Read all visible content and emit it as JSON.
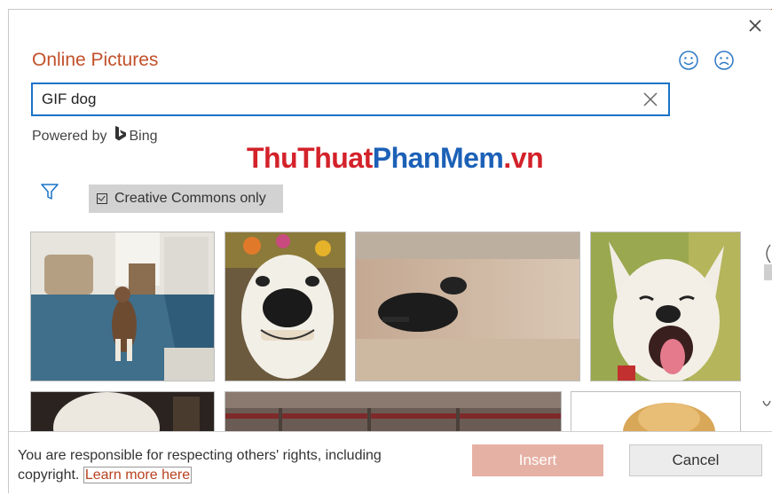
{
  "dialog": {
    "title": "Online Pictures",
    "close_icon": "close-icon",
    "feedback": [
      "smile-icon",
      "frown-icon"
    ]
  },
  "search": {
    "value": "GIF dog",
    "clear_icon": "clear-icon"
  },
  "powered": {
    "label": "Powered by",
    "brand": "Bing"
  },
  "watermark": {
    "part1": "ThuThuat",
    "part2": "PhanMem",
    "part3": ".vn"
  },
  "filter": {
    "icon": "filter-icon",
    "creative_commons_label": "Creative Commons only",
    "creative_commons_checked": true
  },
  "results": [
    "dog in living room",
    "smiling dog with flowers",
    "running dog blur",
    "laughing white dog",
    "white dog partial",
    "fence image partial",
    "golden puppy partial"
  ],
  "footer": {
    "notice_text": "You are responsible for respecting others' rights, including copyright.",
    "learn_more": "Learn more here",
    "insert_label": "Insert",
    "cancel_label": "Cancel"
  },
  "colors": {
    "accent": "#c2502a",
    "link": "#1a73c8",
    "insert_bg": "#e6b1a5"
  }
}
